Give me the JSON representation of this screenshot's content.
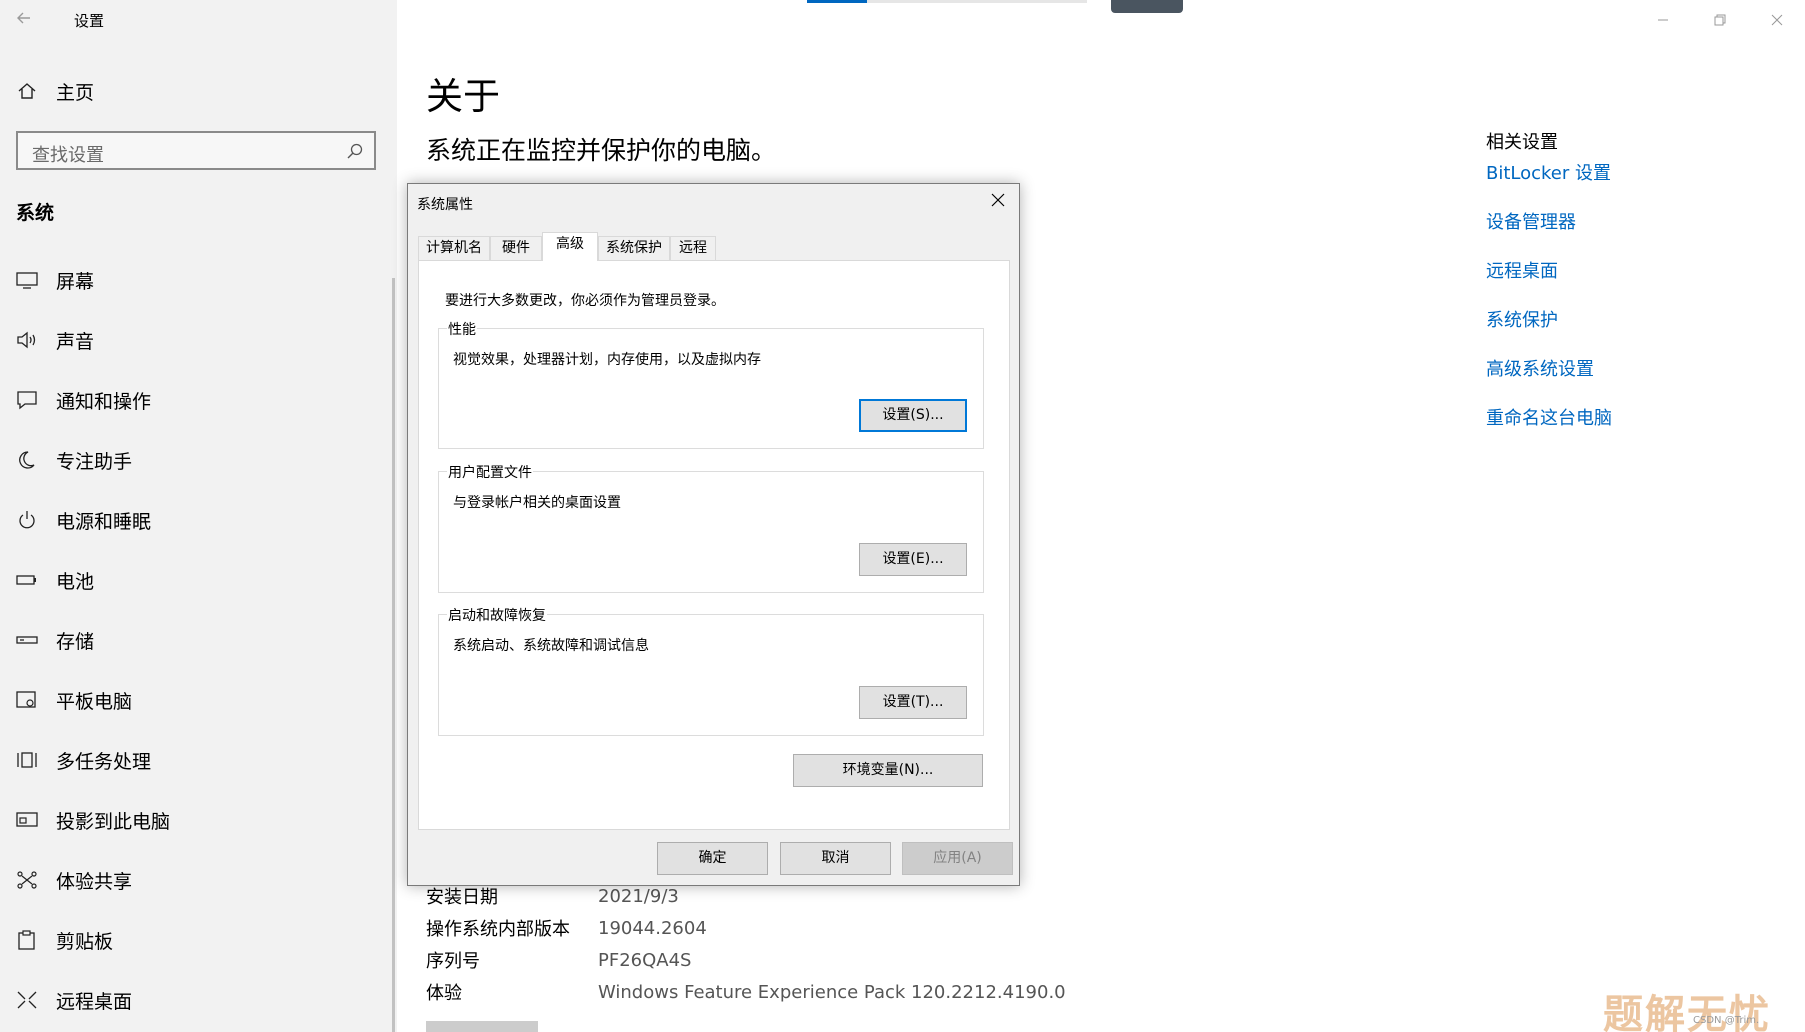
{
  "app": {
    "title": "设置"
  },
  "sidebar": {
    "home_label": "主页",
    "search_placeholder": "查找设置",
    "section_title": "系统",
    "items": [
      {
        "label": "屏幕",
        "icon": "monitor-icon"
      },
      {
        "label": "声音",
        "icon": "speaker-icon"
      },
      {
        "label": "通知和操作",
        "icon": "notification-icon"
      },
      {
        "label": "专注助手",
        "icon": "moon-icon"
      },
      {
        "label": "电源和睡眠",
        "icon": "power-icon"
      },
      {
        "label": "电池",
        "icon": "battery-icon"
      },
      {
        "label": "存储",
        "icon": "storage-icon"
      },
      {
        "label": "平板电脑",
        "icon": "tablet-icon"
      },
      {
        "label": "多任务处理",
        "icon": "multitask-icon"
      },
      {
        "label": "投影到此电脑",
        "icon": "project-icon"
      },
      {
        "label": "体验共享",
        "icon": "share-icon"
      },
      {
        "label": "剪贴板",
        "icon": "clipboard-icon"
      },
      {
        "label": "远程桌面",
        "icon": "remote-icon"
      }
    ]
  },
  "main": {
    "title": "关于",
    "status": "系统正在监控并保护你的电脑。",
    "related": {
      "title": "相关设置",
      "links": [
        "BitLocker 设置",
        "设备管理器",
        "远程桌面",
        "系统保护",
        "高级系统设置",
        "重命名这台电脑"
      ]
    },
    "info": [
      {
        "key": "安装日期",
        "value": "2021/9/3"
      },
      {
        "key": "操作系统内部版本",
        "value": "19044.2604"
      },
      {
        "key": "序列号",
        "value": "PF26QA4S"
      },
      {
        "key": "体验",
        "value": "Windows Feature Experience Pack 120.2212.4190.0"
      }
    ]
  },
  "dialog": {
    "title": "系统属性",
    "tabs": [
      "计算机名",
      "硬件",
      "高级",
      "系统保护",
      "远程"
    ],
    "active_tab": "高级",
    "admin_note": "要进行大多数更改，你必须作为管理员登录。",
    "performance": {
      "title": "性能",
      "desc": "视觉效果，处理器计划，内存使用，以及虚拟内存",
      "button": "设置(S)..."
    },
    "profiles": {
      "title": "用户配置文件",
      "desc": "与登录帐户相关的桌面设置",
      "button": "设置(E)..."
    },
    "startup": {
      "title": "启动和故障恢复",
      "desc": "系统启动、系统故障和调试信息",
      "button": "设置(T)..."
    },
    "env_button": "环境变量(N)...",
    "ok": "确定",
    "cancel": "取消",
    "apply": "应用(A)"
  },
  "watermark": {
    "text": "题解无忧",
    "small": "CSDN @Trim."
  },
  "colors": {
    "accent": "#0067c0",
    "sidebar_bg": "#f2f2f2",
    "dialog_bg": "#f0f0f0"
  }
}
